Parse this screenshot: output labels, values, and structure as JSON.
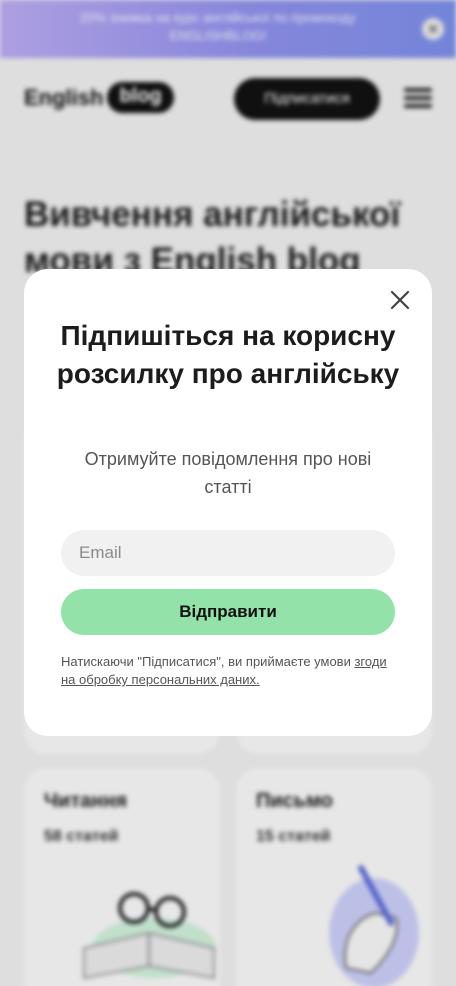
{
  "promo": {
    "text": "20% знижка на курс англійської по промокоду ENGLISHBLOG!",
    "close_icon": "close-icon"
  },
  "header": {
    "logo_word": "English",
    "logo_pill": "blog",
    "subscribe_label": "Підписатися",
    "menu_icon": "hamburger-icon"
  },
  "hero": {
    "title": "Вивчення англійської мови з English blog"
  },
  "categories": [
    {
      "title": "Читання",
      "count": "58 статей"
    },
    {
      "title": "Письмо",
      "count": "15 статей"
    }
  ],
  "modal": {
    "title": "Підпишіться на корисну розсилку про англійську",
    "subtitle": "Отримуйте повідомлення про нові статті",
    "email_placeholder": "Email",
    "email_value": "",
    "submit_label": "Відправити",
    "legal_text": "Натискаючи \"Підписатися\", ви приймаєте умови ",
    "legal_link": "згоди на обробку персональних даних.",
    "close_icon": "close-icon"
  },
  "colors": {
    "promo_gradient_start": "#b9a9ef",
    "promo_gradient_end": "#7b8ee6",
    "submit_bg": "#93e2a9",
    "dark": "#111111"
  }
}
